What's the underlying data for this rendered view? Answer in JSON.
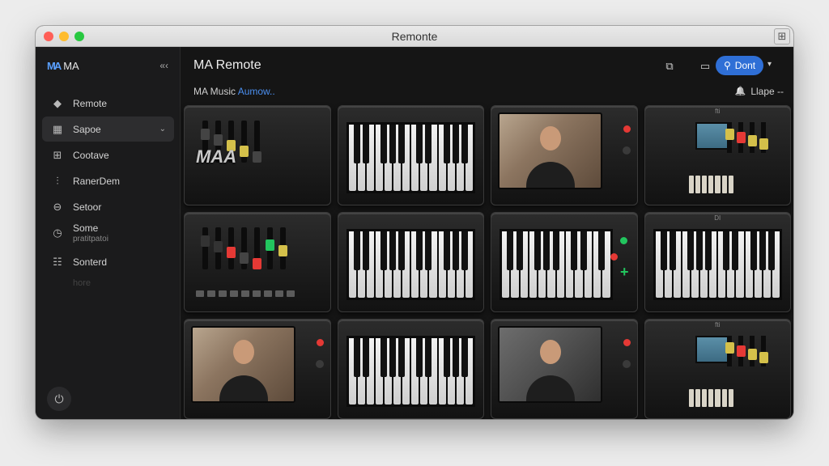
{
  "window": {
    "title": "Remonte"
  },
  "sidebar": {
    "brand_logo": "MA",
    "brand_label": "MA",
    "collapse_glyph": "«‹",
    "items": [
      {
        "label": "Remote",
        "sub": "",
        "icon": "eraser-icon",
        "glyph": "◆",
        "active": false
      },
      {
        "label": "Sapoe",
        "sub": "",
        "icon": "keyboard-icon",
        "glyph": "▦",
        "active": true
      },
      {
        "label": "Cootave",
        "sub": "",
        "icon": "grid-icon",
        "glyph": "⊞",
        "active": false
      },
      {
        "label": "RanerDem",
        "sub": "",
        "icon": "sliders-icon",
        "glyph": "⫶",
        "active": false
      },
      {
        "label": "Setoor",
        "sub": "",
        "icon": "download-circle-icon",
        "glyph": "⊖",
        "active": false
      },
      {
        "label": "Some",
        "sub": "pratitpatoi",
        "icon": "clock-icon",
        "glyph": "◷",
        "active": false
      },
      {
        "label": "Sonterd",
        "sub": "",
        "icon": "calendar-icon",
        "glyph": "☷",
        "active": false
      }
    ],
    "dim_item": "hore",
    "power_glyph": "⏻"
  },
  "header": {
    "title": "MA Remote",
    "subtitle_prefix": "MA Music",
    "subtitle_link": "Aumow..",
    "connect_label": "Dont",
    "connect_glyph": "⚲",
    "caret": "▾",
    "alert_label": "Llape --",
    "alert_glyph": "🔔"
  },
  "tiles": [
    {
      "kind": "controller",
      "label": "",
      "brand": "MAA"
    },
    {
      "kind": "keys",
      "label": ""
    },
    {
      "kind": "video",
      "label": ""
    },
    {
      "kind": "synth",
      "label": "fti"
    },
    {
      "kind": "controller2",
      "label": ""
    },
    {
      "kind": "keys",
      "label": ""
    },
    {
      "kind": "keys-plus",
      "label": ""
    },
    {
      "kind": "keys",
      "label": "DI"
    },
    {
      "kind": "video-small",
      "label": ""
    },
    {
      "kind": "keys",
      "label": ""
    },
    {
      "kind": "video-cool",
      "label": ""
    },
    {
      "kind": "synth",
      "label": "fti"
    }
  ],
  "colors": {
    "accent": "#2f6fd6",
    "link": "#4b8ff0",
    "led_green": "#22c55e",
    "led_red": "#e53935"
  }
}
